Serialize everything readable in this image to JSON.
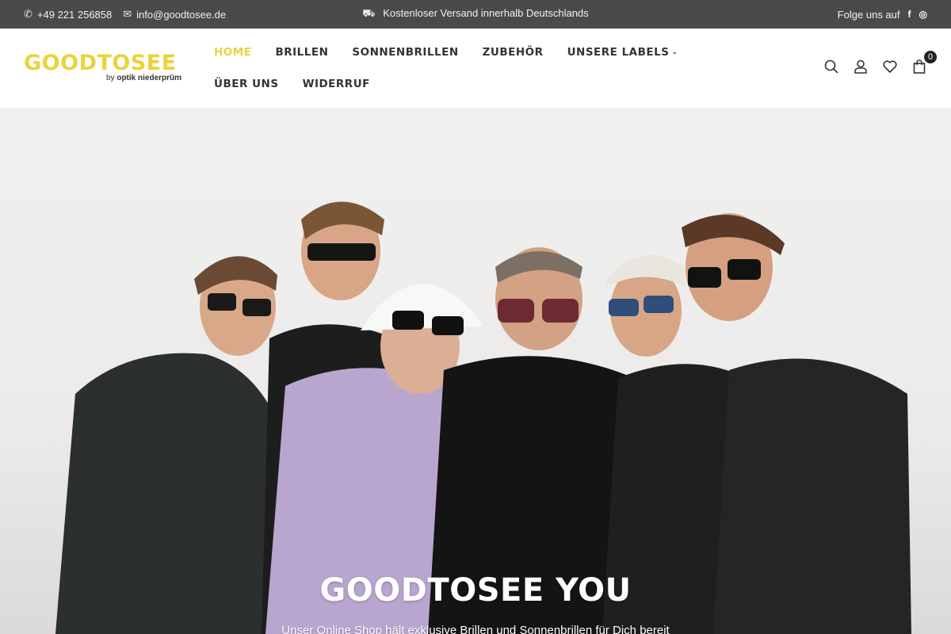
{
  "topbar": {
    "phone": "+49 221 256858",
    "email": "info@goodtosee.de",
    "shipping": "Kostenloser Versand innerhalb Deutschlands",
    "follow": "Folge uns auf",
    "facebook_glyph": "f",
    "instagram_glyph": "◎"
  },
  "logo": {
    "word": "GOODTOSEE",
    "by": "by",
    "sub": "optik niederprüm"
  },
  "nav": {
    "items": [
      {
        "label": "HOME"
      },
      {
        "label": "BRILLEN"
      },
      {
        "label": "SONNENBRILLEN"
      },
      {
        "label": "ZUBEHÖR"
      },
      {
        "label": "UNSERE LABELS"
      },
      {
        "label": "ÜBER UNS"
      },
      {
        "label": "WIDERRUF"
      }
    ],
    "caret": "⌄"
  },
  "cart": {
    "count": "0"
  },
  "hero": {
    "title": "GOODTOSEE YOU",
    "subtitle": "Unser Online Shop hält exklusive Brillen und Sonnenbrillen für Dich bereit"
  },
  "colors": {
    "accent": "#e8d43c",
    "topbar": "#4a4a4a"
  }
}
